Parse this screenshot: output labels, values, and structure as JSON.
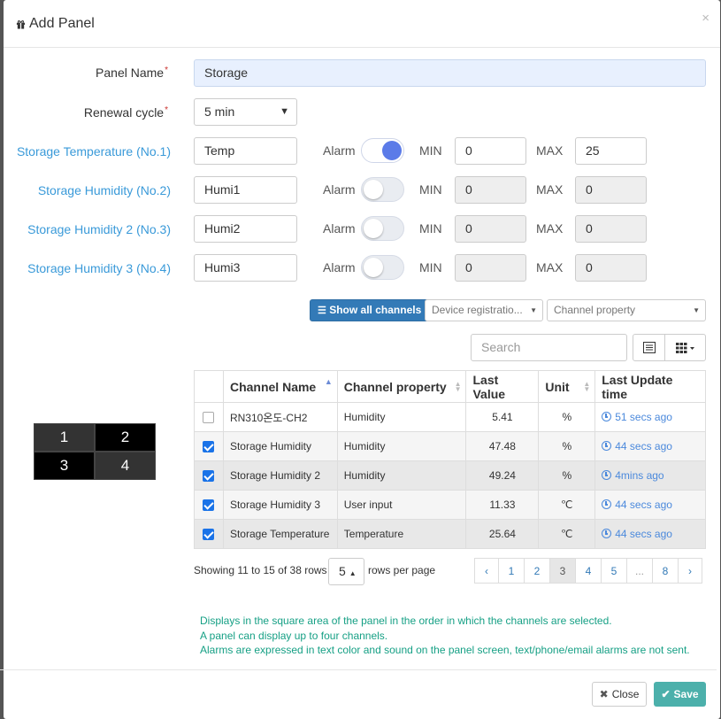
{
  "dialog": {
    "title": "Add Panel",
    "close_symbol": "×"
  },
  "form": {
    "panel_name_label": "Panel Name",
    "panel_name_value": "Storage",
    "renewal_label": "Renewal cycle",
    "renewal_value": "5  min",
    "required_mark": "*"
  },
  "channels": [
    {
      "label": "Storage Temperature (No.1)",
      "name": "Temp",
      "alarm_label": "Alarm",
      "alarm_on": true,
      "min_label": "MIN",
      "min": "0",
      "max_label": "MAX",
      "max": "25"
    },
    {
      "label": "Storage Humidity (No.2)",
      "name": "Humi1",
      "alarm_label": "Alarm",
      "alarm_on": false,
      "min_label": "MIN",
      "min": "0",
      "max_label": "MAX",
      "max": "0"
    },
    {
      "label": "Storage Humidity 2 (No.3)",
      "name": "Humi2",
      "alarm_label": "Alarm",
      "alarm_on": false,
      "min_label": "MIN",
      "min": "0",
      "max_label": "MAX",
      "max": "0"
    },
    {
      "label": "Storage Humidity 3 (No.4)",
      "name": "Humi3",
      "alarm_label": "Alarm",
      "alarm_on": false,
      "min_label": "MIN",
      "min": "0",
      "max_label": "MAX",
      "max": "0"
    }
  ],
  "toolbar": {
    "show_all": "Show all channels",
    "device_filter": "Device registratio...",
    "property_filter": "Channel property",
    "search_placeholder": "Search"
  },
  "table": {
    "headers": [
      "Channel Name",
      "Channel property",
      "Last Value",
      "Unit",
      "Last Update time"
    ],
    "rows": [
      {
        "checked": false,
        "name": "RN310온도-CH2",
        "property": "Humidity",
        "value": "5.41",
        "unit": "%",
        "time": "51 secs ago"
      },
      {
        "checked": true,
        "name": "Storage Humidity",
        "property": "Humidity",
        "value": "47.48",
        "unit": "%",
        "time": "44 secs ago"
      },
      {
        "checked": true,
        "name": "Storage Humidity 2",
        "property": "Humidity",
        "value": "49.24",
        "unit": "%",
        "time": "4mins ago"
      },
      {
        "checked": true,
        "name": "Storage Humidity 3",
        "property": "User input",
        "value": "11.33",
        "unit": "℃",
        "time": "44 secs ago"
      },
      {
        "checked": true,
        "name": "Storage Temperature",
        "property": "Temperature",
        "value": "25.64",
        "unit": "℃",
        "time": "44 secs ago"
      }
    ]
  },
  "pager": {
    "showing": "Showing 11 to 15 of 38 rows",
    "rows_per_page_value": "5",
    "rows_per_page_label": "rows per page",
    "pages": [
      "‹",
      "1",
      "2",
      "3",
      "4",
      "5",
      "...",
      "8",
      "›"
    ],
    "active_page": "3"
  },
  "quad": [
    "1",
    "2",
    "3",
    "4"
  ],
  "notes": [
    "Displays in the square area of the panel in the order in which the channels are selected.",
    "A panel can display up to four channels.",
    "Alarms are expressed in text color and sound on the panel screen, text/phone/email alarms are not sent."
  ],
  "footer": {
    "close": "Close",
    "save": "Save"
  },
  "colors": {
    "primary": "#337ab7",
    "save": "#4cb0ab",
    "link": "#3a9ad9",
    "note": "#16a085",
    "toggle_on": "#5b7be8"
  }
}
